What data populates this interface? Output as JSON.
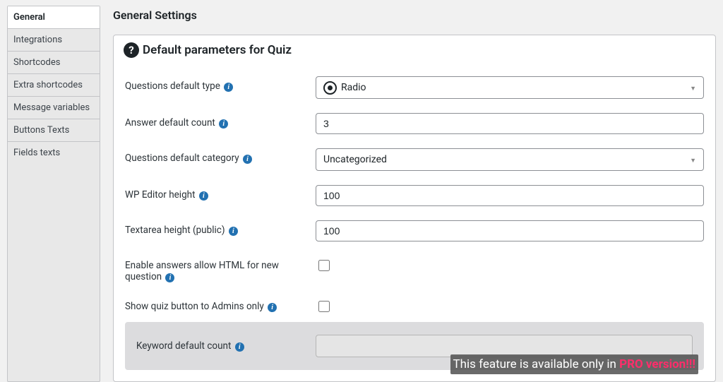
{
  "sidebar": {
    "items": [
      {
        "label": "General"
      },
      {
        "label": "Integrations"
      },
      {
        "label": "Shortcodes"
      },
      {
        "label": "Extra shortcodes"
      },
      {
        "label": "Message variables"
      },
      {
        "label": "Buttons Texts"
      },
      {
        "label": "Fields texts"
      }
    ],
    "active_index": 0
  },
  "page": {
    "title": "General Settings"
  },
  "panel": {
    "title": "Default parameters for Quiz",
    "help_icon_label": "?",
    "info_icon_label": "i"
  },
  "fields": {
    "questions_default_type": {
      "label": "Questions default type",
      "value": "Radio"
    },
    "answer_default_count": {
      "label": "Answer default count",
      "value": "3"
    },
    "questions_default_category": {
      "label": "Questions default category",
      "value": "Uncategorized"
    },
    "wp_editor_height": {
      "label": "WP Editor height",
      "value": "100"
    },
    "textarea_height": {
      "label": "Textarea height (public)",
      "value": "100"
    },
    "enable_answers_html": {
      "label": "Enable answers allow HTML for new question"
    },
    "show_quiz_admins_only": {
      "label": "Show quiz button to Admins only"
    },
    "keyword_default_count": {
      "label": "Keyword default count"
    }
  },
  "pro_notice": {
    "prefix": "This feature is available only in ",
    "pro": "PRO version!!!"
  }
}
